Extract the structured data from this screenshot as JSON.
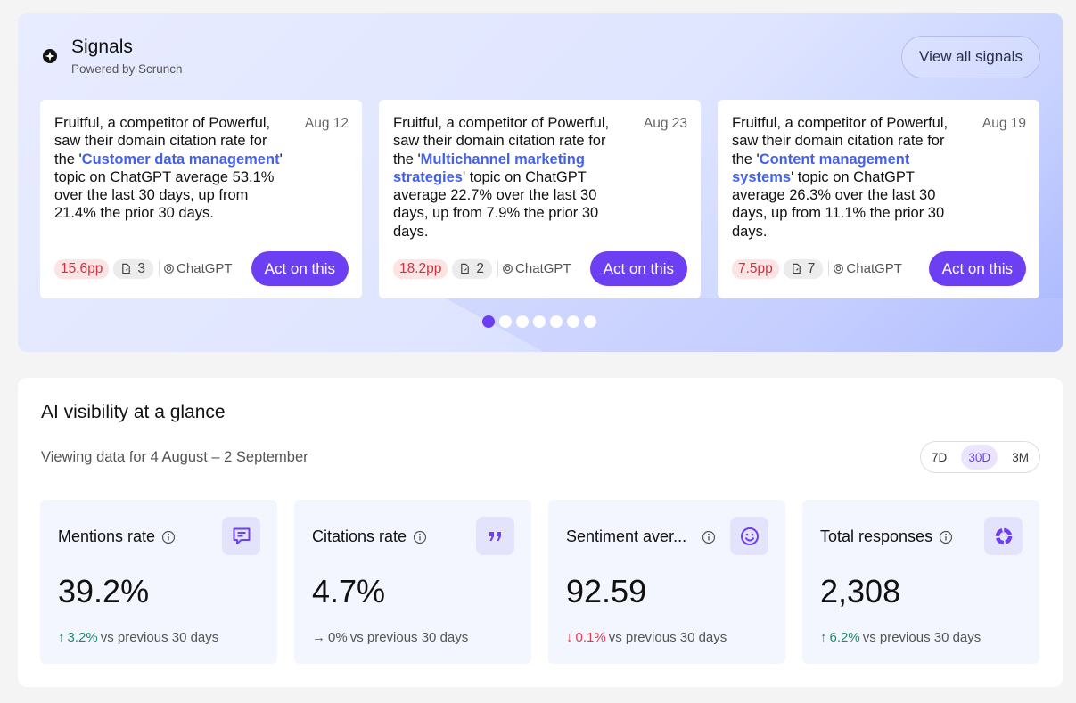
{
  "signals": {
    "title": "Signals",
    "subtitle": "Powered by Scrunch",
    "view_all_label": "View all signals",
    "cards": [
      {
        "text_before": "Fruitful, a competitor of Powerful, saw their domain citation rate for the '",
        "topic": "Customer data management",
        "text_after": "' topic on ChatGPT average 53.1% over the last 30 days, up from 21.4% the prior 30 days.",
        "date": "Aug 12",
        "pp": "15.6pp",
        "count": "3",
        "model": "ChatGPT",
        "action": "Act on this"
      },
      {
        "text_before": "Fruitful, a competitor of Powerful, saw their domain citation rate for the '",
        "topic": "Multichannel marketing strategies",
        "text_after": "' topic on ChatGPT average 22.7% over the last 30 days, up from 7.9% the prior 30 days.",
        "date": "Aug 23",
        "pp": "18.2pp",
        "count": "2",
        "model": "ChatGPT",
        "action": "Act on this"
      },
      {
        "text_before": "Fruitful, a competitor of Powerful, saw their domain citation rate for the '",
        "topic": "Content management systems",
        "text_after": "' topic on ChatGPT average 26.3% over the last 30 days, up from 11.1% the prior 30 days.",
        "date": "Aug 19",
        "pp": "7.5pp",
        "count": "7",
        "model": "ChatGPT",
        "action": "Act on this"
      }
    ],
    "carousel": {
      "pages": 7,
      "active": 0
    }
  },
  "visibility": {
    "title": "AI visibility at a glance",
    "subtitle": "Viewing data for 4 August – 2 September",
    "ranges": [
      "7D",
      "30D",
      "3M"
    ],
    "selected_range": "30D",
    "metrics": [
      {
        "label": "Mentions rate",
        "value": "39.2%",
        "delta": "3.2%",
        "direction": "up",
        "comparison": "vs previous 30 days",
        "icon": "message-icon"
      },
      {
        "label": "Citations rate",
        "value": "4.7%",
        "delta": "0%",
        "direction": "flat",
        "comparison": "vs previous 30 days",
        "icon": "quote-icon"
      },
      {
        "label": "Sentiment aver...",
        "value": "92.59",
        "delta": "0.1%",
        "direction": "down",
        "comparison": "vs previous 30 days",
        "icon": "smile-icon"
      },
      {
        "label": "Total responses",
        "value": "2,308",
        "delta": "6.2%",
        "direction": "up",
        "comparison": "vs previous 30 days",
        "icon": "donut-icon"
      }
    ]
  },
  "colors": {
    "accent": "#6d3ff3",
    "topic_link": "#4361ee",
    "positive": "#1f8a6a",
    "negative": "#e23c4d"
  }
}
